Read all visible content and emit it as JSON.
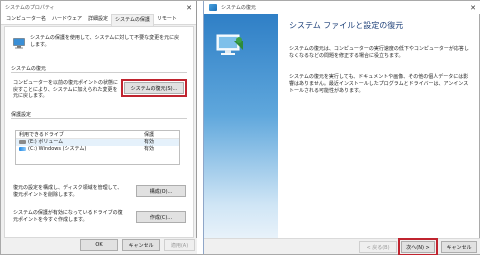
{
  "left": {
    "title": "システムのプロパティ",
    "close_glyph": "✕",
    "tabs": [
      "コンピューター名",
      "ハードウェア",
      "詳細設定",
      "システムの保護",
      "リモート"
    ],
    "intro": "システムの保護を使用して、システムに対して不要な変更を元に戻します。",
    "restore_section": "システムの復元",
    "restore_desc": "コンピューターを以前の復元ポイントの状態に戻すことにより、システムに加えられた変更を元に戻します。",
    "restore_button": "システムの復元(S)...",
    "protection_section": "保護設定",
    "drive_header": "利用できるドライブ",
    "protect_header": "保護",
    "drives": [
      {
        "name": "(E:) ボリューム",
        "status": "有効"
      },
      {
        "name": "(C:) Windows (システム)",
        "status": "有効"
      }
    ],
    "configure_desc": "復元の設定を構成し、ディスク領域を管理して、復元ポイントを削除します。",
    "configure_button": "構成(O)...",
    "create_desc": "システムの保護が有効になっているドライブの復元ポイントを今すぐ作成します。",
    "create_button": "作成(C)...",
    "ok_button": "OK",
    "cancel_button": "キャンセル",
    "apply_button": "適用(A)"
  },
  "right": {
    "title": "システムの復元",
    "close_glyph": "✕",
    "heading": "システム ファイルと設定の復元",
    "para1": "システムの復元は、コンピューターの実行速度の低下やコンピューターが応答しなくなるなどの問題を修正する場合に役立ちます。",
    "para2": "システムの復元を実行しても、ドキュメントや画像、その他の個人データには影響はありません。最近インストールしたプログラムとドライバーは、アンインストールされる可能性があります。",
    "back_button": "< 戻る(B)",
    "next_button": "次へ(N) >",
    "cancel_button": "キャンセル"
  },
  "colors": {
    "highlight": "#c0242f",
    "heading": "#1c3f78",
    "accent": "#2f7fc6"
  }
}
